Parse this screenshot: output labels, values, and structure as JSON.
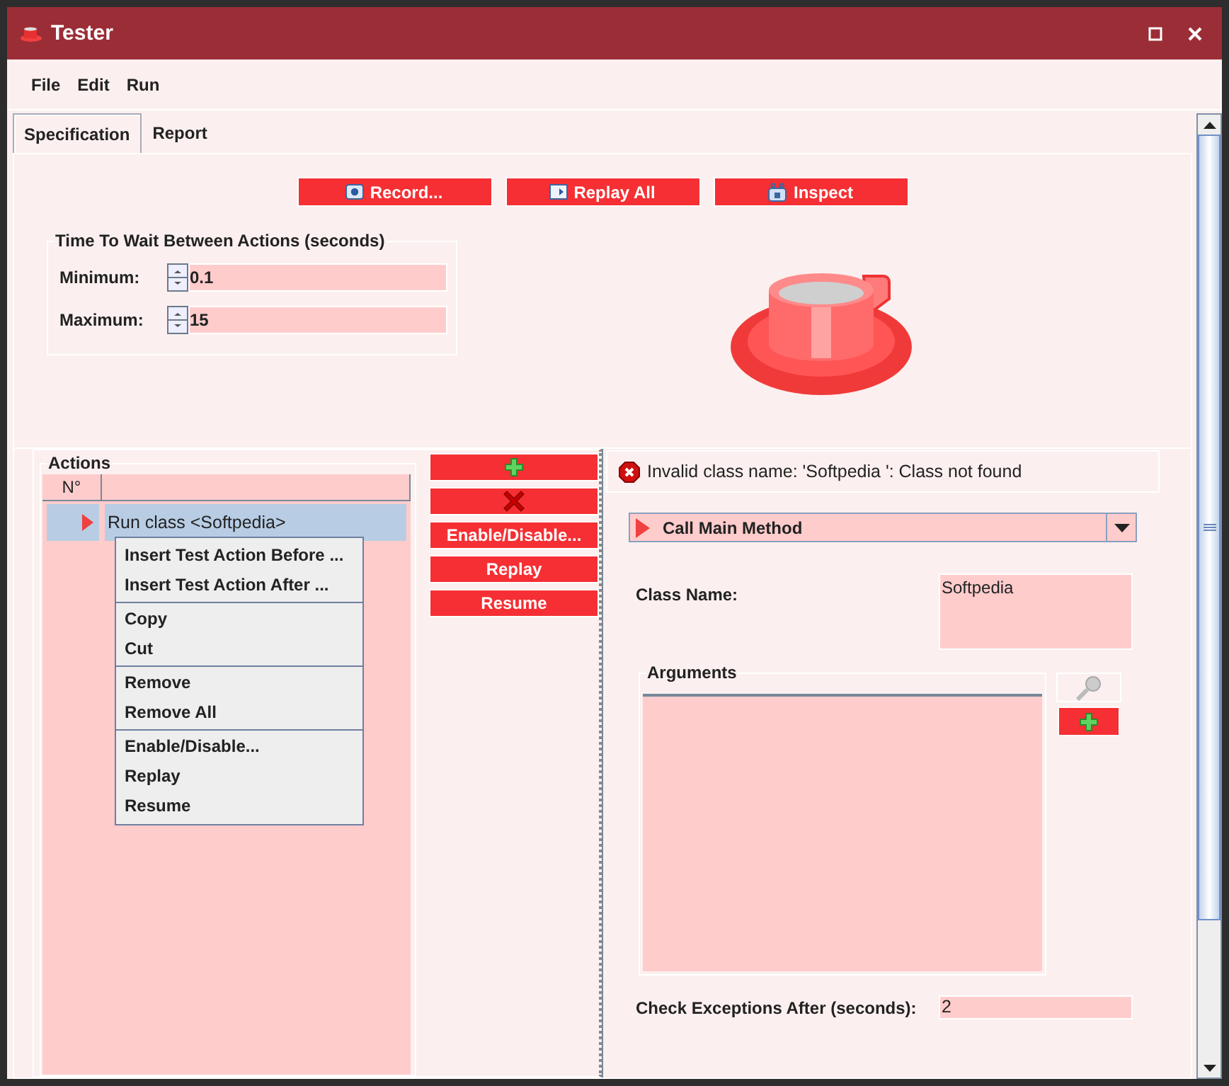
{
  "window": {
    "title": "Tester"
  },
  "menu": [
    "File",
    "Edit",
    "Run"
  ],
  "tabs": [
    {
      "label": "Specification",
      "selected": true
    },
    {
      "label": "Report",
      "selected": false
    }
  ],
  "toolbar": [
    {
      "kind": "record",
      "label": "Record..."
    },
    {
      "kind": "replay",
      "label": "Replay All"
    },
    {
      "kind": "inspect",
      "label": "Inspect"
    }
  ],
  "wait_group": {
    "title": "Time To Wait Between Actions (seconds)",
    "fields": [
      {
        "label": "Minimum:",
        "value": "0.1"
      },
      {
        "label": "Maximum:",
        "value": "15"
      }
    ]
  },
  "actions": {
    "title": "Actions",
    "columns": [
      "N°"
    ],
    "rows": [
      {
        "text": "Run class <Softpedia>",
        "selected": true
      }
    ]
  },
  "action_buttons": [
    {
      "kind": "add"
    },
    {
      "kind": "remove"
    },
    {
      "kind": "text",
      "label": "Enable/Disable..."
    },
    {
      "kind": "text",
      "label": "Replay"
    },
    {
      "kind": "text",
      "label": "Resume"
    }
  ],
  "context_menu": [
    [
      "Insert Test Action Before ...",
      "Insert Test Action After ..."
    ],
    [
      "Copy",
      "Cut"
    ],
    [
      "Remove",
      "Remove All"
    ],
    [
      "Enable/Disable...",
      "Replay",
      "Resume"
    ]
  ],
  "error": "Invalid class name: 'Softpedia ': Class not found",
  "method": {
    "value": "Call Main Method"
  },
  "class_name": {
    "label": "Class Name:",
    "value": "Softpedia"
  },
  "arguments": {
    "title": "Arguments",
    "buttons": [
      {
        "kind": "search"
      },
      {
        "kind": "add"
      }
    ]
  },
  "check_exceptions": {
    "label": "Check Exceptions After (seconds):",
    "value": "2"
  }
}
